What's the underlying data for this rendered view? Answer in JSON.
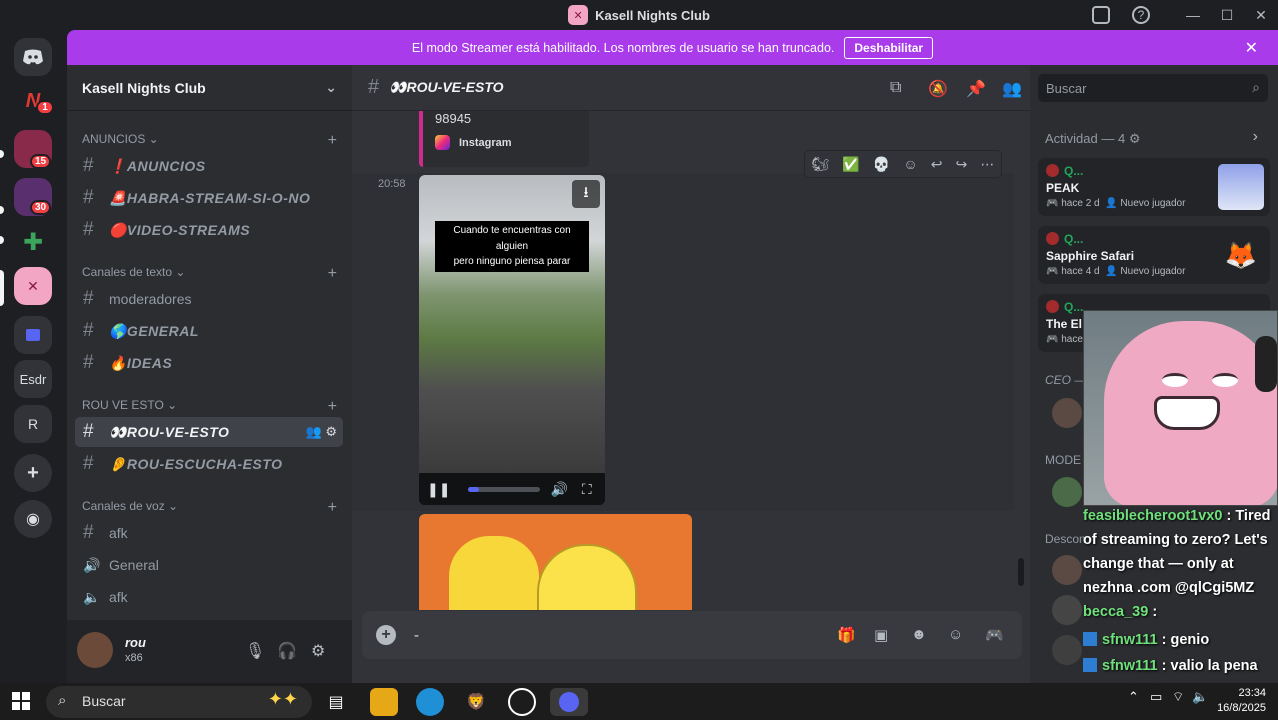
{
  "window": {
    "title": "Kasell Nights Club"
  },
  "colors": {
    "banner": "#a93bea",
    "online": "#23a55a",
    "mention": "#f23f43",
    "accent": "#5865f2"
  },
  "servers": [
    {
      "name": "discord-home",
      "label": ""
    },
    {
      "name": "server-n3",
      "label": "N",
      "badge": "1"
    },
    {
      "name": "server-2",
      "label": "",
      "badge": "15"
    },
    {
      "name": "server-3",
      "label": "",
      "badge": "30"
    },
    {
      "name": "server-4",
      "label": ""
    },
    {
      "name": "server-kasell",
      "label": ""
    },
    {
      "name": "server-folder",
      "label": ""
    },
    {
      "name": "server-esdr",
      "label": "Esdr"
    },
    {
      "name": "server-r",
      "label": "R"
    }
  ],
  "banner": {
    "text": "El modo Streamer está habilitado. Los nombres de usuario se han truncado.",
    "button": "Deshabilitar"
  },
  "sidebar": {
    "guild_name": "Kasell Nights Club",
    "categories": [
      {
        "label": "ANUNCIOS"
      },
      {
        "label": "Canales de texto"
      },
      {
        "label": "ROU VE ESTO"
      },
      {
        "label": "Canales de voz"
      }
    ],
    "channels": {
      "anuncios": "❗ANUNCIOS",
      "habra": "🚨HABRA-STREAM-SI-O-NO",
      "videos": "🔴VIDEO-STREAMS",
      "moderadores": "moderadores",
      "general": "🌎GENERAL",
      "ideas": "🔥IDEAS",
      "rouve": "👀ROU-VE-ESTO",
      "rouescucha": "👂ROU-ESCUCHA-ESTO",
      "afk_text": "afk",
      "general_voice": "General",
      "afk_voice": "afk"
    }
  },
  "user": {
    "name": "rou",
    "tag": "x86"
  },
  "chat": {
    "channel_name": "👀ROU-VE-ESTO",
    "embed_number": "98945",
    "embed_source": "Instagram",
    "timestamp": "20:58",
    "video_caption_1": "Cuando te encuentras con alguien",
    "video_caption_2": "pero ninguno piensa parar",
    "composer_text": "-",
    "video_progress": 0.14
  },
  "right_panel": {
    "search_placeholder": "Buscar",
    "activity_title": "Actividad — 4",
    "activities": [
      {
        "user": "Q...",
        "game": "PEAK",
        "meta": "hace 2 d",
        "tag": "Nuevo jugador"
      },
      {
        "user": "Q...",
        "game": "Sapphire Safari",
        "meta": "hace 4 d",
        "tag": "Nuevo jugador"
      },
      {
        "user": "Q...",
        "game": "The El",
        "meta": "hace"
      }
    ],
    "sections": [
      "CEO —",
      "MODE",
      "Descon"
    ]
  },
  "stream_chat": [
    {
      "user": "feasiblecheroot1vx0",
      "msg": "Tired of streaming to zero? Let's change that — only at nezhna .com @qlCgi5MZ"
    },
    {
      "user": "becca_39",
      "msg": ""
    },
    {
      "user": "sfnw111",
      "msg": "genio"
    },
    {
      "user": "sfnw111",
      "msg": "valio la pena estar despierto"
    }
  ],
  "taskbar": {
    "search_placeholder": "Buscar",
    "time": "23:34",
    "date": "16/8/2025"
  }
}
